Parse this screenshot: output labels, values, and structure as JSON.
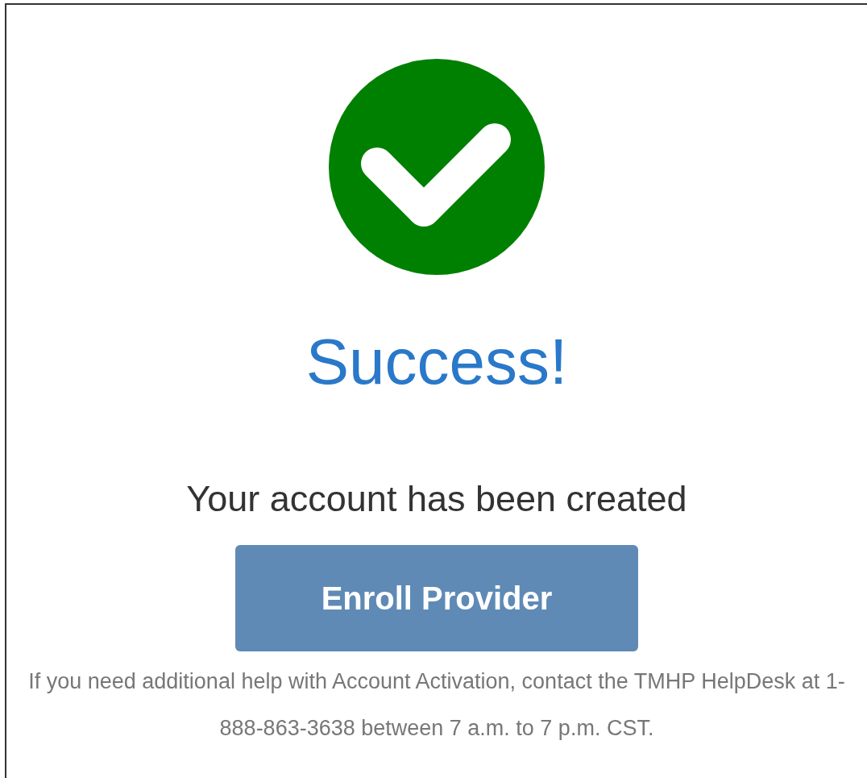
{
  "status": {
    "kind": "success",
    "title": "Success!"
  },
  "message": "Your account has been created",
  "button": {
    "label": "Enroll Provider"
  },
  "help_text": "If you need additional help with Account Activation, contact the TMHP HelpDesk at 1-888-863-3638 between 7 a.m. to 7 p.m. CST."
}
